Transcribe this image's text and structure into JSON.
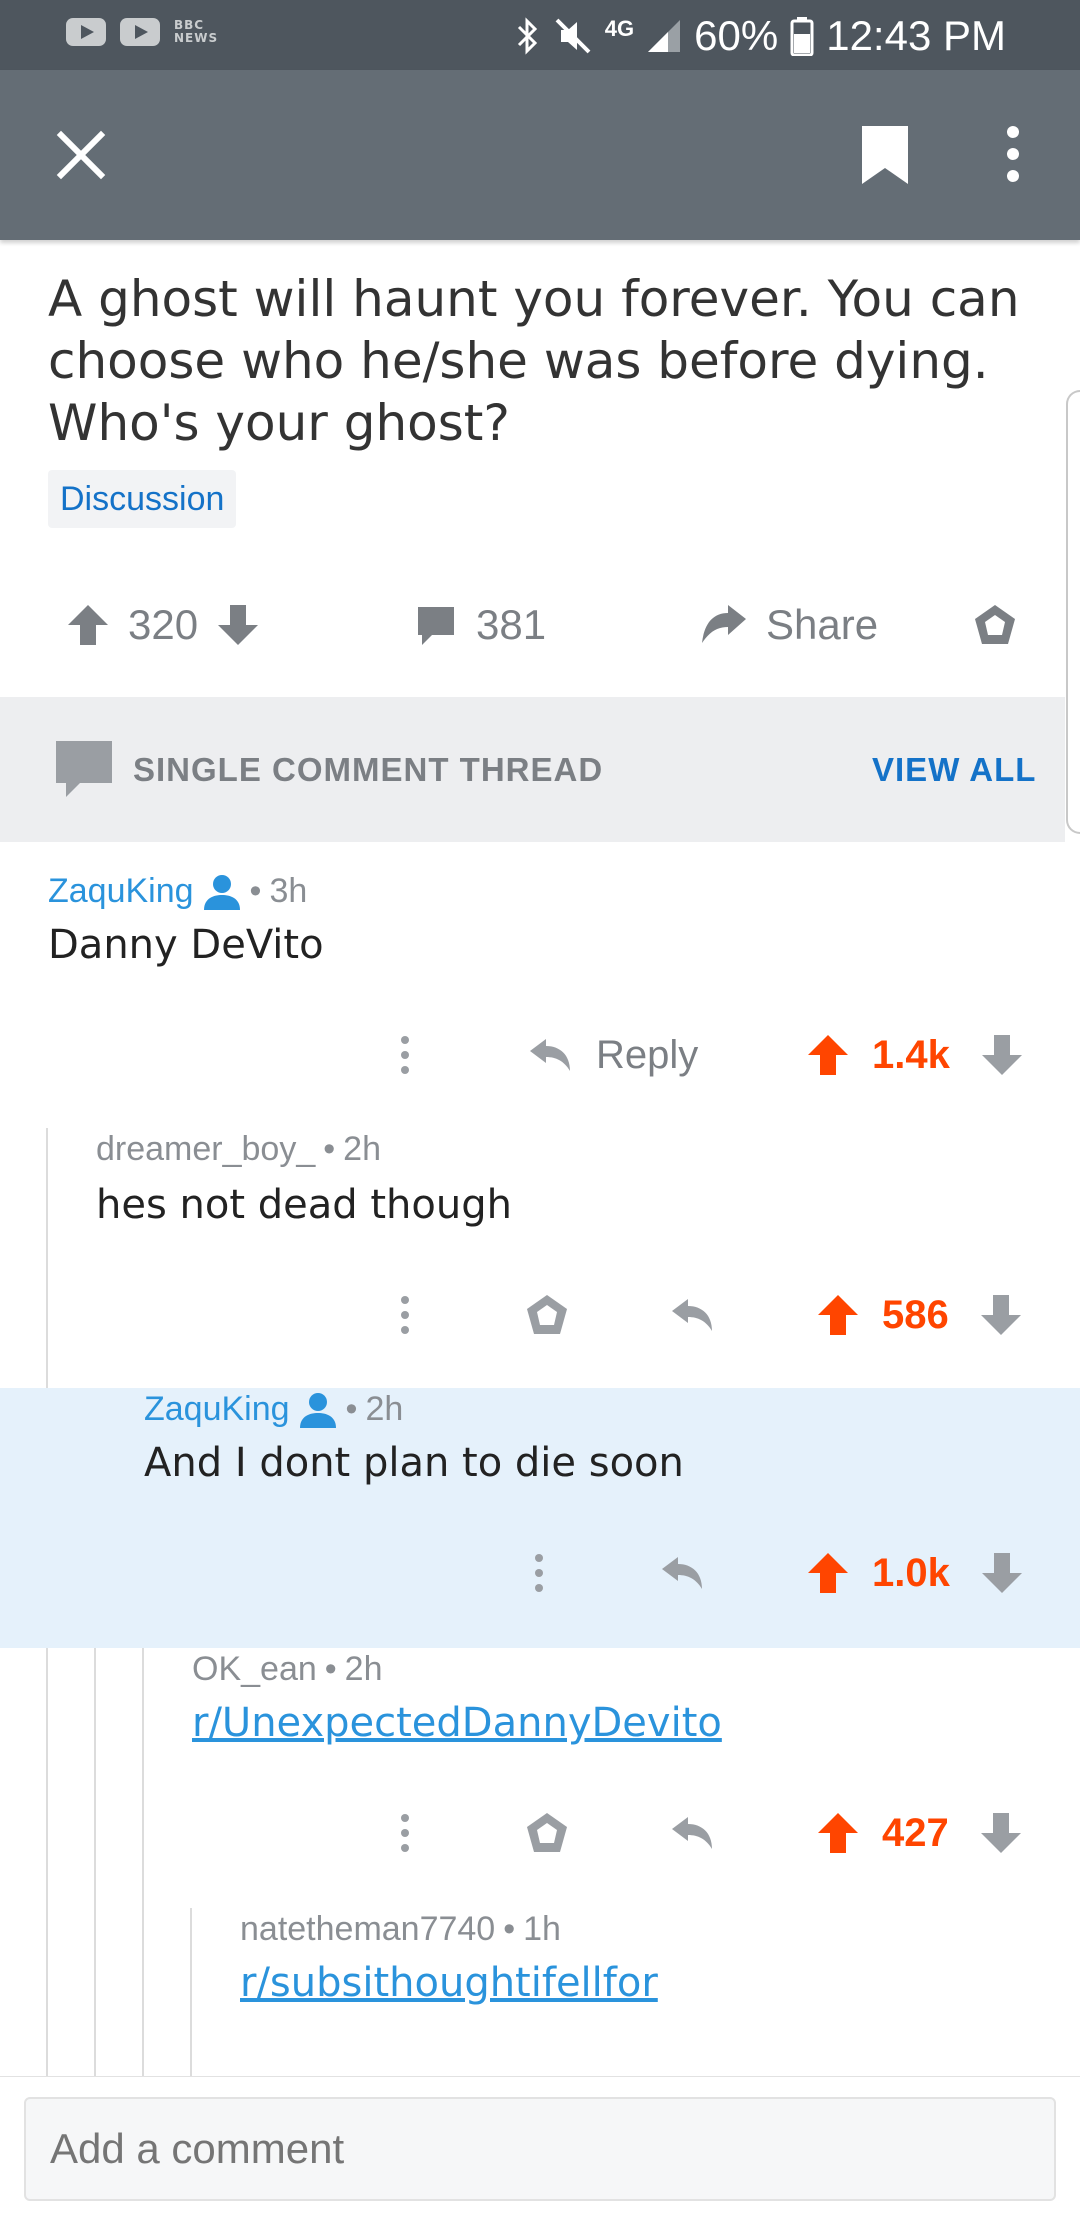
{
  "status_bar": {
    "bbc_logo": "BBC NEWS",
    "network": "4G",
    "battery": "60%",
    "time": "12:43 PM"
  },
  "app_bar": {
    "close_icon": "close-icon",
    "bookmark_icon": "bookmark-icon",
    "more_icon": "more-vertical-icon"
  },
  "post": {
    "title": "A ghost will haunt you forever. You can choose who he/she was before dying. Who's your ghost?",
    "flair": "Discussion",
    "votes": "320",
    "comments": "381",
    "share_label": "Share"
  },
  "thread_bar": {
    "label": "SINGLE COMMENT THREAD",
    "view_all": "VIEW ALL"
  },
  "comments": [
    {
      "author": "ZaquKing",
      "op": true,
      "age": "3h",
      "body": "Danny DeVito",
      "reply_label": "Reply",
      "score": "1.4k"
    },
    {
      "author": "dreamer_boy_",
      "op": false,
      "age": "2h",
      "body": "hes not dead though",
      "score": "586"
    },
    {
      "author": "ZaquKing",
      "op": true,
      "age": "2h",
      "body": "And I dont plan to die soon",
      "score": "1.0k"
    },
    {
      "author": "OK_ean",
      "op": false,
      "age": "2h",
      "body": "r/UnexpectedDannyDevito",
      "score": "427"
    },
    {
      "author": "natetheman7740",
      "op": false,
      "age": "1h",
      "body": "r/subsithoughtifellfor"
    }
  ],
  "bottom": {
    "comment_placeholder": "Add a comment"
  },
  "colors": {
    "status_bar": "#4e565e",
    "app_bar": "#646d75",
    "upvote": "#ff4500",
    "link": "#2a93dc",
    "highlight": "#e5f1fb"
  }
}
